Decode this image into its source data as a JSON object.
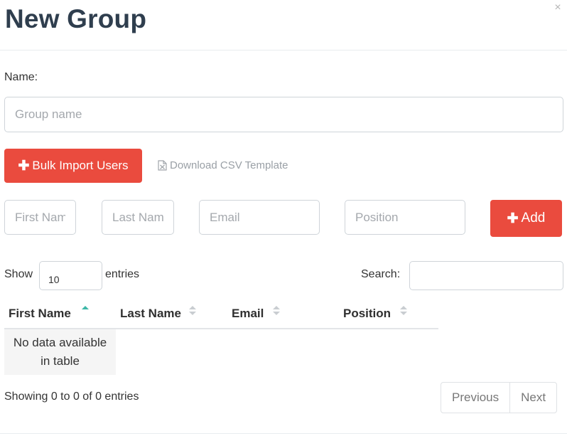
{
  "modal": {
    "title": "New Group",
    "close_glyph": "×"
  },
  "form": {
    "name_label": "Name:",
    "group_name_placeholder": "Group name",
    "bulk_import_label": "Bulk Import Users",
    "download_csv_label": "Download CSV Template",
    "first_name_placeholder": "First Name",
    "last_name_placeholder": "Last Name",
    "email_placeholder": "Email",
    "position_placeholder": "Position",
    "add_label": "Add"
  },
  "table_controls": {
    "show_label": "Show",
    "entries_label": "entries",
    "page_length": "10",
    "search_label": "Search:"
  },
  "table": {
    "columns": [
      "First Name",
      "Last Name",
      "Email",
      "Position"
    ],
    "empty_message": "No data available in table"
  },
  "pagination": {
    "info": "Showing 0 to 0 of 0 entries",
    "previous": "Previous",
    "next": "Next"
  },
  "colors": {
    "accent": "#ea4b3e",
    "title": "#2f3e4e",
    "sort_active": "#3cb7a7"
  },
  "icons": {
    "plus": "plus-icon",
    "csv": "csv-file-icon",
    "sort": "sort-icon",
    "close": "close-icon"
  }
}
